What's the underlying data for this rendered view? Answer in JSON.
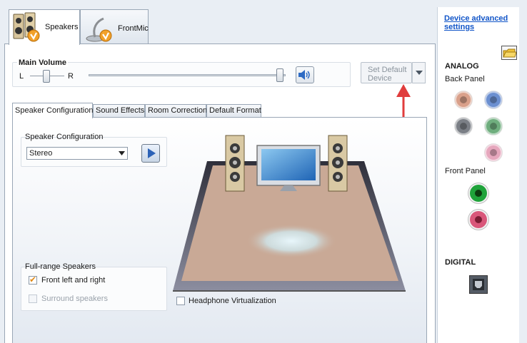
{
  "device_tabs": [
    {
      "label": "Speakers",
      "icon": "speakers-icon",
      "active": true
    },
    {
      "label": "FrontMic",
      "icon": "microphone-icon",
      "active": false
    }
  ],
  "main_volume": {
    "title": "Main Volume",
    "left_label": "L",
    "right_label": "R",
    "balance": 0.5,
    "volume": 1.0,
    "mute_icon": "speaker-volume-icon"
  },
  "set_default": {
    "line1": "Set Default",
    "line2": "Device",
    "dropdown_icon": "triangle-down-icon"
  },
  "sub_tabs": [
    "Speaker Configuration",
    "Sound Effects",
    "Room Correction",
    "Default Format"
  ],
  "speaker_config": {
    "group_title": "Speaker Configuration",
    "selected": "Stereo",
    "play_icon": "play-icon"
  },
  "full_range": {
    "group_title": "Full-range Speakers",
    "front": {
      "label": "Front left and right",
      "checked": true
    },
    "surround": {
      "label": "Surround speakers",
      "checked": false,
      "disabled": true
    }
  },
  "headphone": {
    "label": "Headphone Virtualization",
    "checked": false
  },
  "sidebar": {
    "link_line1": "Device advanced",
    "link_line2": "settings",
    "folder_icon": "folder-icon",
    "analog_title": "ANALOG",
    "back_panel_title": "Back Panel",
    "back_jacks": [
      "#d9a08a",
      "#6b8fd0",
      "#7b7f86",
      "#6fae7e",
      "#e6a7bd"
    ],
    "front_panel_title": "Front Panel",
    "front_jacks": [
      "#1fa33a",
      "#d9577a"
    ],
    "digital_title": "DIGITAL",
    "digital_icon": "optical-port-icon"
  },
  "colors": {
    "accent": "#e08a17",
    "link": "#1155c8",
    "arrow": "#e03c3c",
    "floor": "#c9a996",
    "panel_border": "#9aa7b6"
  }
}
